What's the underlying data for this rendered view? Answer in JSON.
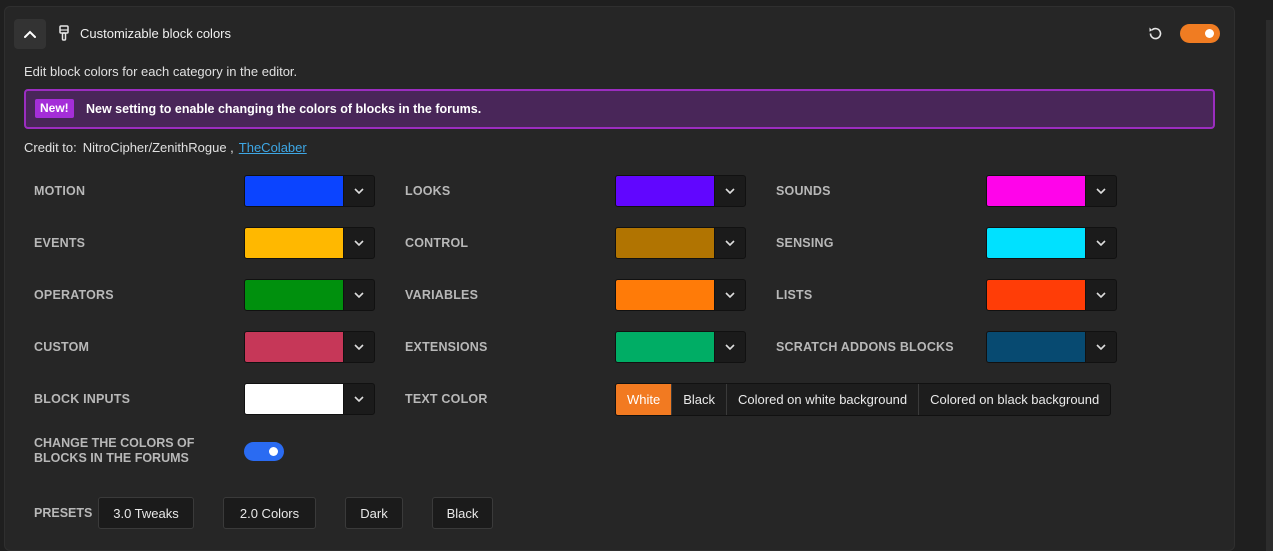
{
  "header": {
    "title": "Customizable block colors",
    "main_toggle_on": true
  },
  "description": "Edit block colors for each category in the editor.",
  "notice": {
    "badge": "New!",
    "text": "New setting to enable changing the colors of blocks in the forums."
  },
  "credit": {
    "label": "Credit to:",
    "name": "NitroCipher/ZenithRogue ,",
    "link": "TheColaber"
  },
  "colors": [
    {
      "label": "MOTION",
      "color": "#0b44ff"
    },
    {
      "label": "LOOKS",
      "color": "#6106ff"
    },
    {
      "label": "SOUNDS",
      "color": "#ff04ea"
    },
    {
      "label": "EVENTS",
      "color": "#ffb800"
    },
    {
      "label": "CONTROL",
      "color": "#b17401"
    },
    {
      "label": "SENSING",
      "color": "#00e1ff"
    },
    {
      "label": "OPERATORS",
      "color": "#00900d"
    },
    {
      "label": "VARIABLES",
      "color": "#ff7b08"
    },
    {
      "label": "LISTS",
      "color": "#ff3d07"
    },
    {
      "label": "CUSTOM",
      "color": "#c63758"
    },
    {
      "label": "EXTENSIONS",
      "color": "#00ad65"
    },
    {
      "label": "SCRATCH ADDONS BLOCKS",
      "color": "#074a71"
    },
    {
      "label": "BLOCK INPUTS",
      "color": "#ffffff"
    }
  ],
  "text_color": {
    "label": "TEXT COLOR",
    "options": [
      "White",
      "Black",
      "Colored on white background",
      "Colored on black background"
    ],
    "selected": "White"
  },
  "forums": {
    "label_line1": "CHANGE THE COLORS OF",
    "label_line2": "BLOCKS IN THE FORUMS",
    "enabled": true
  },
  "presets": {
    "label": "PRESETS",
    "buttons": [
      "3.0 Tweaks",
      "2.0 Colors",
      "Dark",
      "Black"
    ]
  }
}
